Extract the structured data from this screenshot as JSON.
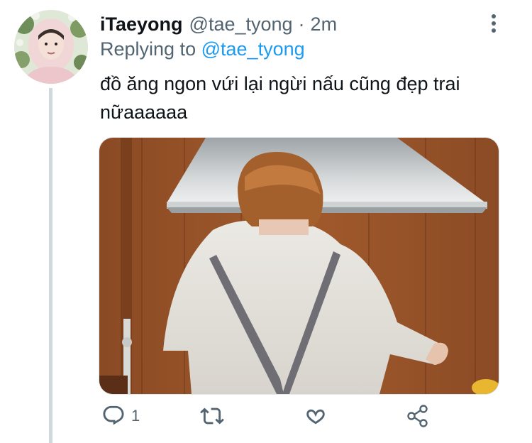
{
  "tweet": {
    "display_name": "iTaeyong",
    "handle": "@tae_tyong",
    "separator": "·",
    "time": "2m",
    "replying_prefix": "Replying to",
    "replying_to": "@tae_tyong",
    "text": "đồ ăng ngon vứi lại ngừi nấu cũng đẹp trai nữaaaaaa"
  },
  "actions": {
    "reply_count": "1"
  },
  "colors": {
    "accent": "#1d9bf0",
    "secondary_text": "#536471",
    "thread_line": "#cfd9de",
    "icon": "#536471"
  },
  "icons": [
    "more-icon",
    "reply-icon",
    "retweet-icon",
    "like-icon",
    "share-icon"
  ]
}
